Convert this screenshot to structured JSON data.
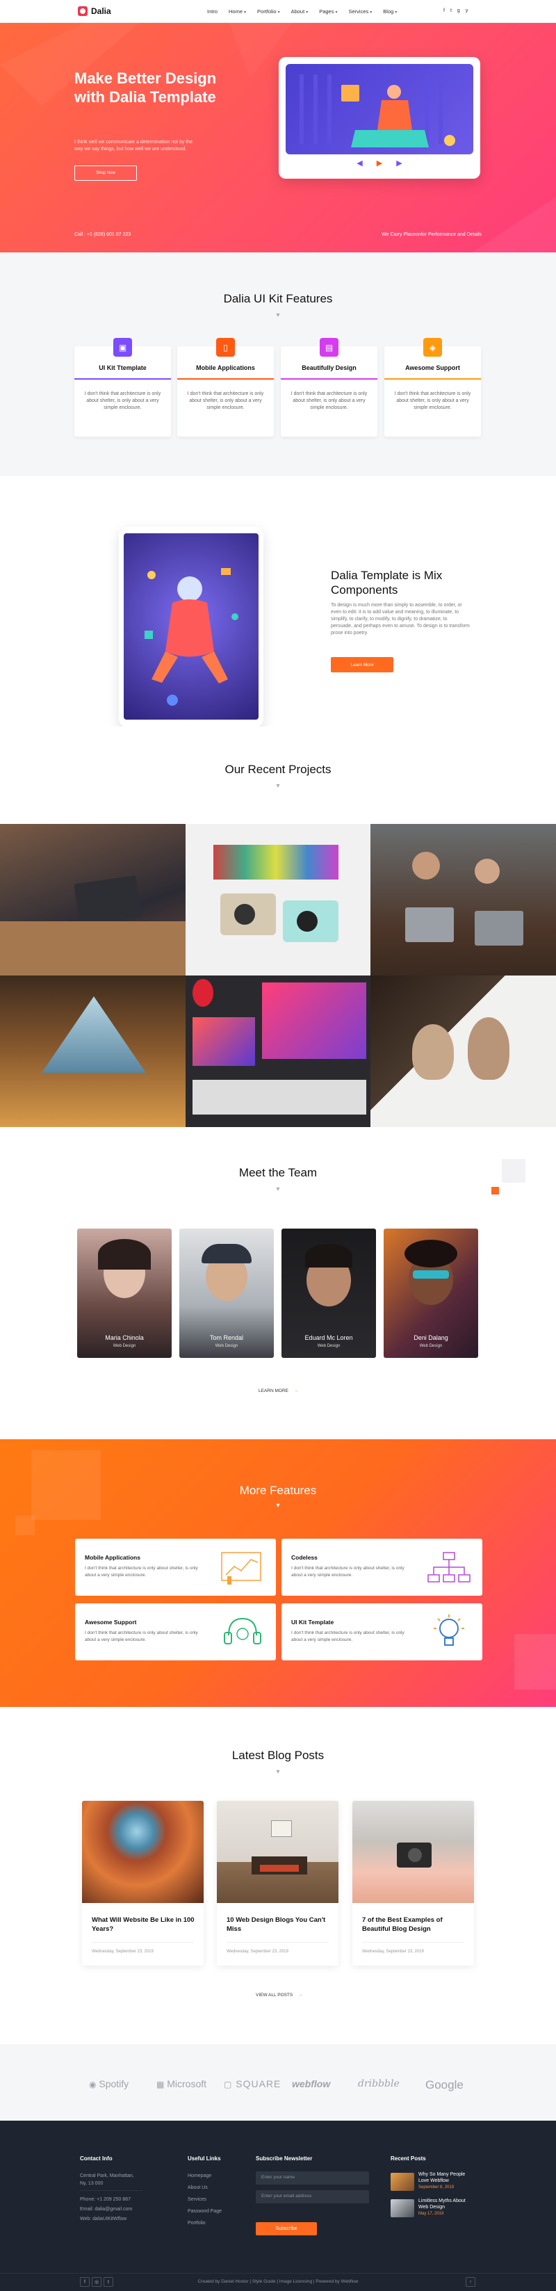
{
  "nav": {
    "logo": "Dalia",
    "items": [
      {
        "label": "Intro",
        "caret": false
      },
      {
        "label": "Home",
        "caret": true
      },
      {
        "label": "Portfolio",
        "caret": true
      },
      {
        "label": "About",
        "caret": true
      },
      {
        "label": "Pages",
        "caret": true
      },
      {
        "label": "Services",
        "caret": true
      },
      {
        "label": "Blog",
        "caret": true
      }
    ],
    "social": [
      "f",
      "t",
      "g",
      "y"
    ]
  },
  "hero": {
    "title": "Make Better Design with Dalia Template",
    "text": "I think well we communicate a determination not by the way we say things, but how well we are understood.",
    "button": "Shop Now",
    "call": "Call : +1 (628) 601 07 223",
    "perf": "We Carry Placeonfor Performance and Details"
  },
  "features": {
    "title": "Dalia UI Kit Features",
    "cards": [
      {
        "title": "UI Kit Ttemplate",
        "text": "I don't think that architecture is only about shelter, is only about a very simple enclosure.",
        "color": "#7b4dff",
        "icon": "monitor-icon"
      },
      {
        "title": "Mobile Applications",
        "text": "I don't think that architecture is only about shelter, is only about a very simple enclosure.",
        "color": "#ff5a12",
        "icon": "mobile-icon"
      },
      {
        "title": "Beautifully Design",
        "text": "I don't think that architecture is only about shelter, is only about a very simple enclosure.",
        "color": "#d53cf0",
        "icon": "design-icon"
      },
      {
        "title": "Awesome Support",
        "text": "I don't think that architecture is only about shelter, is only about a very simple enclosure.",
        "color": "#ff9a0e",
        "icon": "support-icon"
      }
    ]
  },
  "mix": {
    "title": "Dalia Template is Mix Components",
    "text": "To design is much more than simply to assemble, to order, or even to edit: it is to add value and meaning, to illuminate, to simplify, to clarify, to modify, to dignify, to dramatize, to persuade, and perhaps even to amuse. To design is to transform prose into poetry.",
    "button": "Learn More"
  },
  "projects": {
    "title": "Our Recent Projects"
  },
  "team": {
    "title": "Meet the Team",
    "members": [
      {
        "name": "Maria Chinola",
        "role": "Web Design"
      },
      {
        "name": "Tom Rendal",
        "role": "Web Design"
      },
      {
        "name": "Eduard Mc Loren",
        "role": "Web Design"
      },
      {
        "name": "Deni Dalang",
        "role": "Web Design"
      }
    ],
    "learn": "LEARN MORE"
  },
  "more": {
    "title": "More Features",
    "cards": [
      {
        "title": "Mobile Applications",
        "text": "I don't think that architecture is only about shelter, is only about a very simple enclosure."
      },
      {
        "title": "Codeless",
        "text": "I don't think that architecture is only about shelter, is only about a very simple enclosure."
      },
      {
        "title": "Awesome Support",
        "text": "I don't think that architecture is only about shelter, is only about a very simple enclosure."
      },
      {
        "title": "UI Kit Template",
        "text": "I don't think that architecture is only about shelter, is only about a very simple enclosure."
      }
    ]
  },
  "blog": {
    "title": "Latest Blog Posts",
    "posts": [
      {
        "title": "What Will Website Be Like in 100 Years?",
        "date": "Wednesday, September 23, 2019"
      },
      {
        "title": "10 Web Design Blogs You Can't Miss",
        "date": "Wednesday, September 23, 2019"
      },
      {
        "title": "7 of the Best Examples of Beautiful Blog Design",
        "date": "Wednesday, September 23, 2019"
      }
    ],
    "view_all": "VIEW ALL POSTS"
  },
  "brands": [
    "Spotify",
    "Microsoft",
    "SQUARE",
    "webflow",
    "dribbble",
    "Google"
  ],
  "footer": {
    "contact_title": "Contact Info",
    "address": [
      "Central Park, Manhattan,",
      "Ny, 13 000"
    ],
    "phone": "Phone: +1 209 250 867",
    "email": "Email: dalia@gmail.com",
    "web": "Web: daliaUIKitWflow",
    "links_title": "Useful Links",
    "links": [
      "Homepage",
      "About Us",
      "Services",
      "Password Page",
      "Portfolio"
    ],
    "newsletter_title": "Subscribe Newsletter",
    "name_placeholder": "Enter your name",
    "email_placeholder": "Enter your email address",
    "subscribe": "Subscribe",
    "recent_title": "Recent Posts",
    "recent": [
      {
        "title": "Why So Many People Love Webflow",
        "date": "September 8, 2019"
      },
      {
        "title": "Limitless Myths About Web Design",
        "date": "May 17, 2019"
      }
    ],
    "copyright": "Created by Daniel Hostor | Style Guide | Image Licensing | Powered by Webflow"
  }
}
